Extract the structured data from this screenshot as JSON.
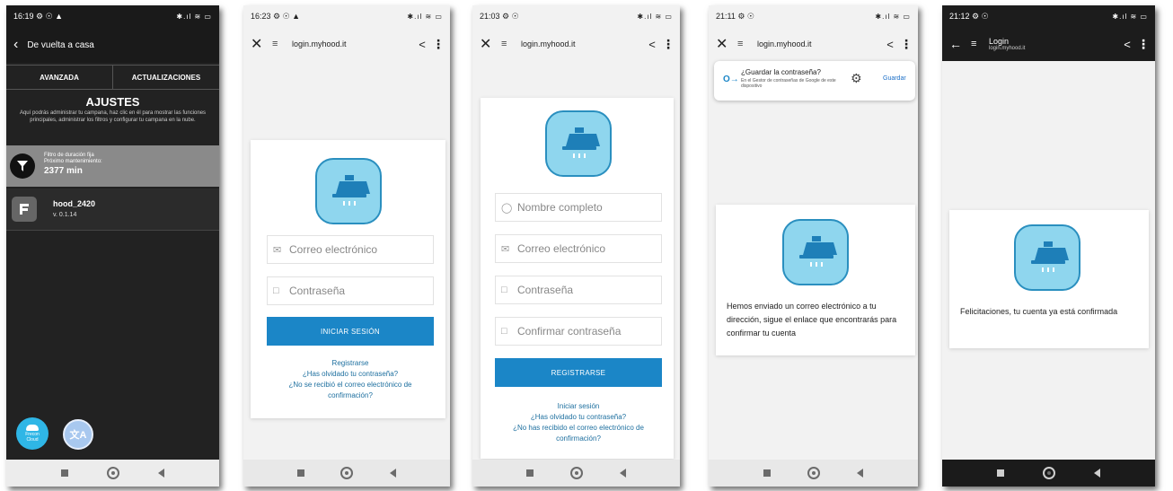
{
  "phone1": {
    "time": "16:19 ⚙ ☉ ▲",
    "status_right": "✱.ıl ≋ ▭",
    "back_title": "De vuelta a casa",
    "tabs": [
      "AVANZADA",
      "ACTUALIZACIONES"
    ],
    "settings_title": "AJUSTES",
    "settings_desc": "Aquí podrás administrar tu campana, haz clic en él para mostrar las funciones principales, administrar los filtros y configurar tu campana en la nube.",
    "filter_title": "Filtro de duración fija",
    "filter_sub": "Próximo mantenimiento:",
    "filter_value": "2377 min",
    "device_name": "hood_2420",
    "device_version": "v. 0.1.14",
    "fab1_label": "Frecon Cloud",
    "fab2_label": "文A"
  },
  "phone2": {
    "time": "16:23 ⚙ ☉ ▲",
    "status_right": "✱.ıl ≋ ▭",
    "url": "login.myhood.it",
    "email_placeholder": "Correo electrónico",
    "password_placeholder": "Contraseña",
    "login_button": "INICIAR SESIÓN",
    "register_link": "Registrarse",
    "forgot_link": "¿Has olvidado tu contraseña?",
    "noemail_link": "¿No se recibió el correo electrónico de confirmación?"
  },
  "phone3": {
    "time": "21:03 ⚙ ☉",
    "status_right": "✱.ıl ≋ ▭",
    "url": "login.myhood.it",
    "name_placeholder": "Nombre completo",
    "email_placeholder": "Correo electrónico",
    "password_placeholder": "Contraseña",
    "confirm_placeholder": "Confirmar contraseña",
    "register_button": "REGISTRARSE",
    "login_link": "Iniciar sesión",
    "forgot_link": "¿Has olvidado tu contraseña?",
    "noemail_link": "¿No has recibido el correo electrónico de confirmación?"
  },
  "phone4": {
    "time": "21:11 ⚙ ☉",
    "status_right": "✱.ıl ≋ ▭",
    "url": "login.myhood.it",
    "save_prompt_title": "¿Guardar la contraseña?",
    "save_prompt_desc": "En el Gestor de contraseñas de Google de este dispositivo",
    "save_button": "Guardar",
    "message": "Hemos enviado un correo electrónico a tu dirección, sigue el enlace que encontrarás para confirmar tu cuenta"
  },
  "phone5": {
    "time": "21:12 ⚙ ☉",
    "status_right": "✱.ıl ≋ ▭",
    "title": "Login",
    "url": "login.myhood.it",
    "message": "Felicitaciones, tu cuenta ya está confirmada"
  },
  "colors": {
    "accent": "#1b86c7",
    "logo_bg": "#8fd6ee",
    "logo_border": "#2a8fbf",
    "link": "#1d6f9f",
    "dark_bg": "#222222"
  }
}
